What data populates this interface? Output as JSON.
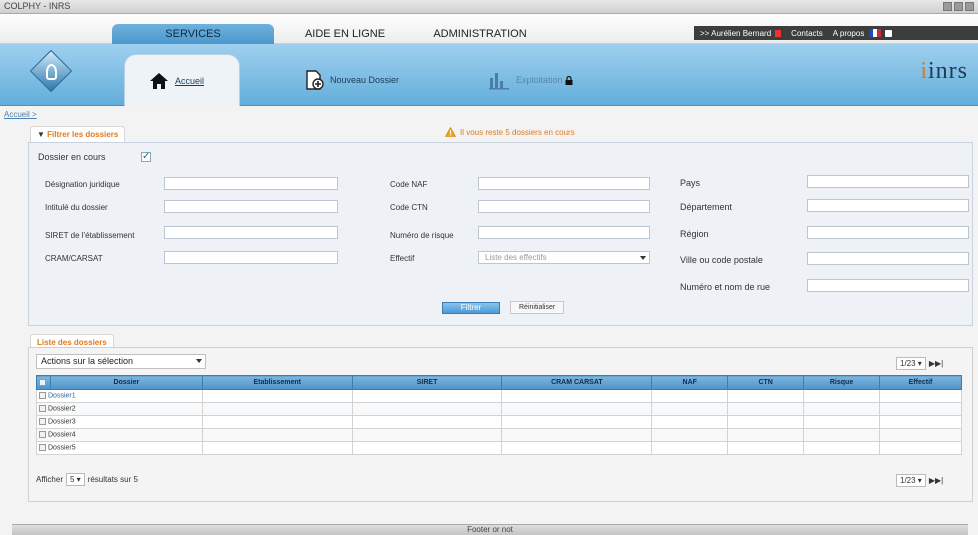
{
  "window": {
    "title": "COLPHY - INRS"
  },
  "topnav": {
    "tabs": [
      {
        "label": "SERVICES",
        "active": true
      },
      {
        "label": "AIDE EN LIGNE",
        "active": false
      },
      {
        "label": "ADMINISTRATION",
        "active": false
      }
    ],
    "user": ">> Aurélien Bernard",
    "contacts": "Contacts",
    "about": "A propos"
  },
  "banner": {
    "tabs": [
      {
        "label": "Accueil",
        "icon": "home-icon",
        "active": true
      },
      {
        "label": "Nouveau Dossier",
        "icon": "new-folder-icon",
        "active": false
      },
      {
        "label": "Exploitation",
        "icon": "chart-bars-icon",
        "active": false,
        "locked": true
      }
    ],
    "brand": "inrs"
  },
  "breadcrumb": "Accueil >",
  "filter": {
    "title": "Filtrer les dossiers",
    "warning": "Il vous reste 5 dossiers en cours",
    "dossier_en_cours_label": "Dossier en cours",
    "dossier_en_cours_checked": true,
    "col1": [
      "Désignation juridique",
      "Intitulé du dossier",
      "SIRET de l'établissement",
      "CRAM/CARSAT"
    ],
    "col2": [
      "Code NAF",
      "Code CTN",
      "Numéro de risque",
      "Effectif"
    ],
    "col3": [
      "Pays",
      "Département",
      "Région",
      "Ville ou code postale",
      "Numéro et nom de rue"
    ],
    "effectif_placeholder": "Liste des effectifs",
    "filter_button": "Filtrer",
    "reset_button": "Réinitialiser"
  },
  "list": {
    "title": "Liste des dossiers",
    "actions_label": "Actions sur la sélection",
    "pager": "1/23",
    "columns": [
      "Dossier",
      "Etablissement",
      "SIRET",
      "CRAM CARSAT",
      "NAF",
      "CTN",
      "Risque",
      "Effectif"
    ],
    "rows": [
      {
        "dossier": "Dossier1",
        "link": true
      },
      {
        "dossier": "Dossier2",
        "link": false
      },
      {
        "dossier": "Dossier3",
        "link": false
      },
      {
        "dossier": "Dossier4",
        "link": false
      },
      {
        "dossier": "Dossier5",
        "link": false
      }
    ],
    "show_label": "Afficher",
    "show_count": "5",
    "results_text": "résultats sur 5"
  },
  "footer": "Footer or not"
}
